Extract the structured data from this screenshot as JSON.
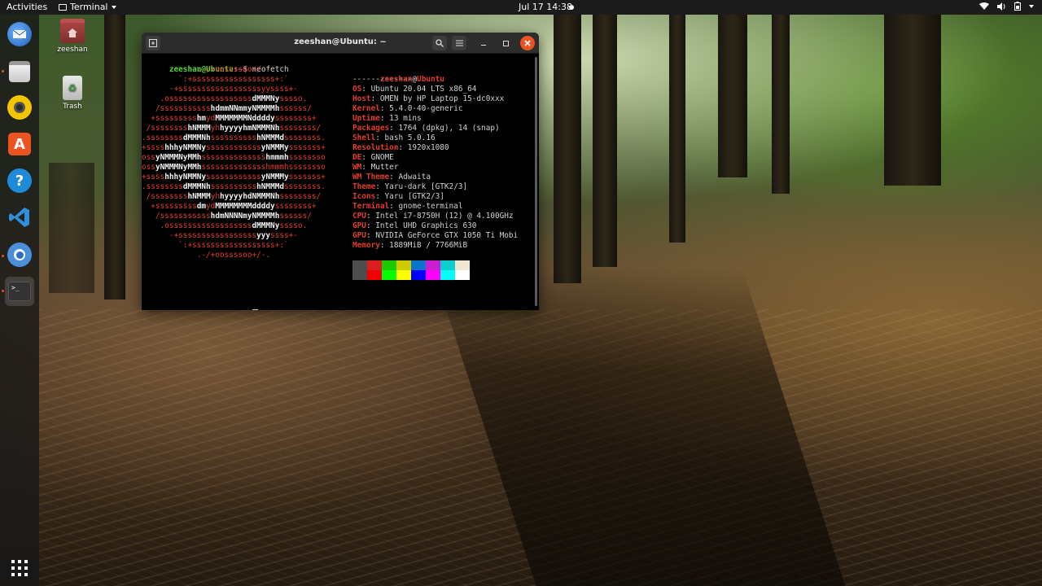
{
  "topbar": {
    "activities": "Activities",
    "app_menu": "Terminal",
    "clock": "Jul 17  14:38"
  },
  "desktop": {
    "icons": [
      {
        "label": "zeeshan"
      },
      {
        "label": "Trash"
      }
    ]
  },
  "dock": {
    "items": [
      {
        "name": "thunderbird-icon"
      },
      {
        "name": "files-icon"
      },
      {
        "name": "rhythmbox-icon"
      },
      {
        "name": "software-icon"
      },
      {
        "name": "help-icon"
      },
      {
        "name": "vscode-icon"
      },
      {
        "name": "chromium-icon"
      },
      {
        "name": "terminal-icon"
      }
    ],
    "show_apps": "show-apps-icon"
  },
  "terminal": {
    "title": "zeeshan@Ubuntu: ~",
    "prompt_user": "zeeshan@Ubuntu",
    "prompt_sep": ":",
    "prompt_path": "~",
    "prompt_sign": "$",
    "command": "neofetch",
    "user_host": {
      "user": "zeeshan",
      "at": "@",
      "host": "Ubuntu"
    },
    "divider": "--------------",
    "info": [
      {
        "key": "OS",
        "value": "Ubuntu 20.04 LTS x86_64"
      },
      {
        "key": "Host",
        "value": "OMEN by HP Laptop 15-dc0xxx"
      },
      {
        "key": "Kernel",
        "value": "5.4.0-40-generic"
      },
      {
        "key": "Uptime",
        "value": "13 mins"
      },
      {
        "key": "Packages",
        "value": "1764 (dpkg), 14 (snap)"
      },
      {
        "key": "Shell",
        "value": "bash 5.0.16"
      },
      {
        "key": "Resolution",
        "value": "1920x1080"
      },
      {
        "key": "DE",
        "value": "GNOME"
      },
      {
        "key": "WM",
        "value": "Mutter"
      },
      {
        "key": "WM Theme",
        "value": "Adwaita"
      },
      {
        "key": "Theme",
        "value": "Yaru-dark [GTK2/3]"
      },
      {
        "key": "Icons",
        "value": "Yaru [GTK2/3]"
      },
      {
        "key": "Terminal",
        "value": "gnome-terminal"
      },
      {
        "key": "CPU",
        "value": "Intel i7-8750H (12) @ 4.100GHz"
      },
      {
        "key": "GPU",
        "value": "Intel UHD Graphics 630"
      },
      {
        "key": "GPU",
        "value": "NVIDIA GeForce GTX 1050 Ti Mobi"
      },
      {
        "key": "Memory",
        "value": "1889MiB / 7766MiB"
      }
    ],
    "logo": [
      [
        {
          "t": "            .-/+oossssoo+/-.",
          "c": "r"
        }
      ],
      [
        {
          "t": "        `:+ssssssssssssssssss+:`",
          "c": "r"
        }
      ],
      [
        {
          "t": "      -+ssssssssssssssssssyyssss+-",
          "c": "r"
        }
      ],
      [
        {
          "t": "    .ossssssssssssssssss",
          "c": "r"
        },
        {
          "t": "dMMMNy",
          "c": "w"
        },
        {
          "t": "sssso.",
          "c": "r"
        }
      ],
      [
        {
          "t": "   /sssssssssss",
          "c": "r"
        },
        {
          "t": "hdmmNNmmyNMMMMh",
          "c": "w"
        },
        {
          "t": "ssssss/",
          "c": "r"
        }
      ],
      [
        {
          "t": "  +sssssssss",
          "c": "r"
        },
        {
          "t": "hm",
          "c": "w"
        },
        {
          "t": "yd",
          "c": "r"
        },
        {
          "t": "MMMMMMMNddddy",
          "c": "w"
        },
        {
          "t": "ssssssss+",
          "c": "r"
        }
      ],
      [
        {
          "t": " /ssssssss",
          "c": "r"
        },
        {
          "t": "hNMMM",
          "c": "w"
        },
        {
          "t": "yh",
          "c": "r"
        },
        {
          "t": "hyyyyhmNMMMNh",
          "c": "w"
        },
        {
          "t": "ssssssss/",
          "c": "r"
        }
      ],
      [
        {
          "t": ".ssssssss",
          "c": "r"
        },
        {
          "t": "dMMMNh",
          "c": "w"
        },
        {
          "t": "ssssssssss",
          "c": "r"
        },
        {
          "t": "hNMMMd",
          "c": "w"
        },
        {
          "t": "ssssssss.",
          "c": "r"
        }
      ],
      [
        {
          "t": "+ssss",
          "c": "r"
        },
        {
          "t": "hhhyNMMNy",
          "c": "w"
        },
        {
          "t": "ssssssssssss",
          "c": "r"
        },
        {
          "t": "yNMMMy",
          "c": "w"
        },
        {
          "t": "sssssss+",
          "c": "r"
        }
      ],
      [
        {
          "t": "oss",
          "c": "r"
        },
        {
          "t": "yNMMMNyMMh",
          "c": "w"
        },
        {
          "t": "ssssssssssssss",
          "c": "r"
        },
        {
          "t": "hmmmh",
          "c": "w"
        },
        {
          "t": "ssssssso",
          "c": "r"
        }
      ],
      [
        {
          "t": "oss",
          "c": "r"
        },
        {
          "t": "yNMMMNyMMh",
          "c": "w"
        },
        {
          "t": "sssssssssssssshmmmhssssssso",
          "c": "r"
        }
      ],
      [
        {
          "t": "+ssss",
          "c": "r"
        },
        {
          "t": "hhhyNMMNy",
          "c": "w"
        },
        {
          "t": "ssssssssssss",
          "c": "r"
        },
        {
          "t": "yNMMMy",
          "c": "w"
        },
        {
          "t": "sssssss+",
          "c": "r"
        }
      ],
      [
        {
          "t": ".ssssssss",
          "c": "r"
        },
        {
          "t": "dMMMNh",
          "c": "w"
        },
        {
          "t": "ssssssssss",
          "c": "r"
        },
        {
          "t": "hNMMMd",
          "c": "w"
        },
        {
          "t": "ssssssss.",
          "c": "r"
        }
      ],
      [
        {
          "t": " /ssssssss",
          "c": "r"
        },
        {
          "t": "hNMMM",
          "c": "w"
        },
        {
          "t": "yh",
          "c": "r"
        },
        {
          "t": "hyyyyhdNMMMNh",
          "c": "w"
        },
        {
          "t": "ssssssss/",
          "c": "r"
        }
      ],
      [
        {
          "t": "  +sssssssss",
          "c": "r"
        },
        {
          "t": "dm",
          "c": "w"
        },
        {
          "t": "yd",
          "c": "r"
        },
        {
          "t": "MMMMMMMMddddy",
          "c": "w"
        },
        {
          "t": "ssssssss+",
          "c": "r"
        }
      ],
      [
        {
          "t": "   /sssssssssss",
          "c": "r"
        },
        {
          "t": "hdmNNNNmyNMMMMh",
          "c": "w"
        },
        {
          "t": "ssssss/",
          "c": "r"
        }
      ],
      [
        {
          "t": "    .ossssssssssssssssss",
          "c": "r"
        },
        {
          "t": "dMMMNy",
          "c": "w"
        },
        {
          "t": "sssso.",
          "c": "r"
        }
      ],
      [
        {
          "t": "      -+sssssssssssssssss",
          "c": "r"
        },
        {
          "t": "yyy",
          "c": "w"
        },
        {
          "t": "ssss+-",
          "c": "r"
        }
      ],
      [
        {
          "t": "        `:+ssssssssssssssssss+:`",
          "c": "r"
        }
      ],
      [
        {
          "t": "            .-/+oossssoo+/-.",
          "c": "r"
        }
      ]
    ],
    "palette_top": [
      "#4d4d4d",
      "#d81e1e",
      "#19cb00",
      "#cecb00",
      "#0d73cc",
      "#cb1ed1",
      "#0dcdcd",
      "#eee8d5"
    ],
    "palette_bottom": [
      "#4d4d4d",
      "#f00000",
      "#00ff00",
      "#ffff00",
      "#0000ff",
      "#ff00ff",
      "#00ffff",
      "#ffffff"
    ]
  }
}
